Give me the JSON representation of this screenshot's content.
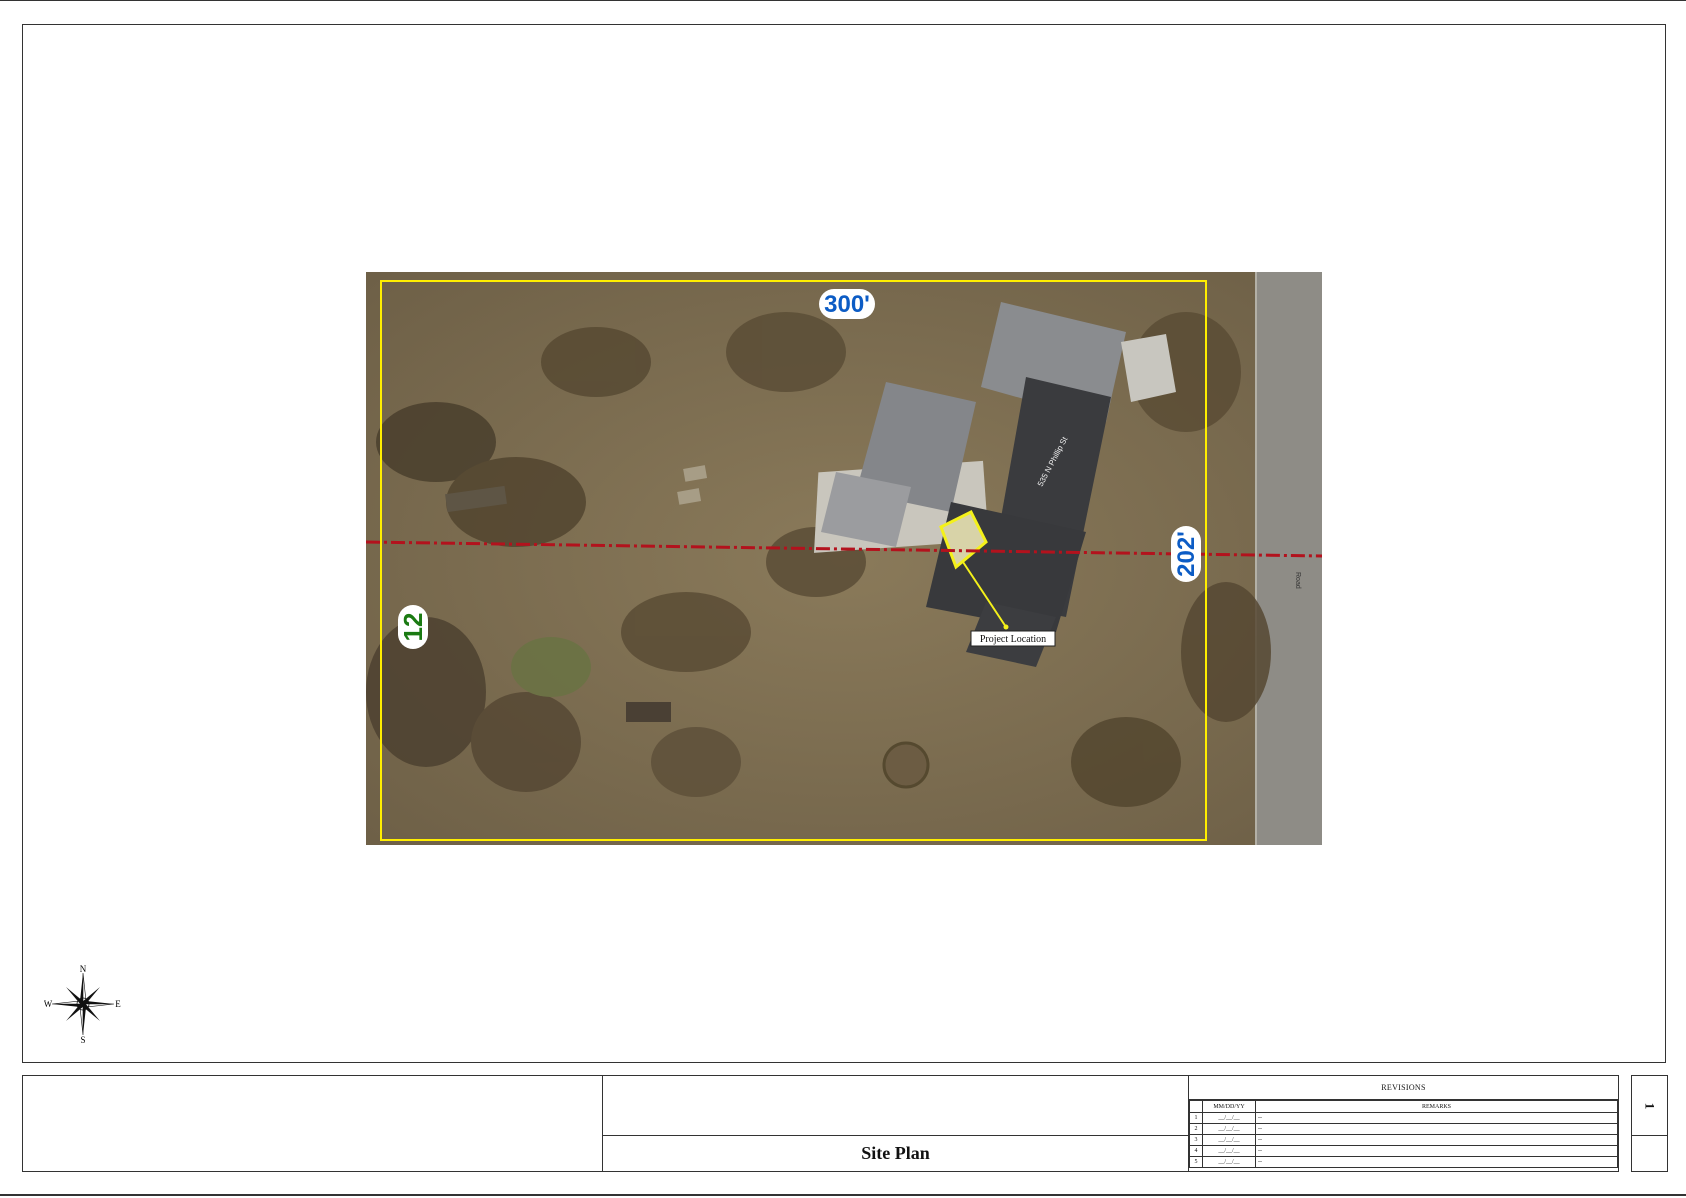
{
  "site_plan": {
    "dimension_top": "300'",
    "dimension_right": "202'",
    "left_label": "12",
    "callout": "Project Location",
    "road_label": "Road",
    "address_label": "535 N Phillip St",
    "colors": {
      "property_line": "#ffee00",
      "centerline": "#b3121d",
      "dimension_label": "#0c5cc5",
      "left_label": "#1a7a12",
      "ground": "#7e6f52",
      "roof": "#3e3f42"
    }
  },
  "compass": {
    "n": "N",
    "e": "E",
    "s": "S",
    "w": "W"
  },
  "title_block": {
    "sheet_title": "Site Plan",
    "sheet_number": "1",
    "revisions": {
      "title": "REVISIONS",
      "col_date": "MM/DD/YY",
      "col_remarks": "REMARKS",
      "rows": [
        {
          "num": "1",
          "date": "__/__/__",
          "remarks": "--"
        },
        {
          "num": "2",
          "date": "__/__/__",
          "remarks": "--"
        },
        {
          "num": "3",
          "date": "__/__/__",
          "remarks": "--"
        },
        {
          "num": "4",
          "date": "__/__/__",
          "remarks": "--"
        },
        {
          "num": "5",
          "date": "__/__/__",
          "remarks": "--"
        }
      ]
    }
  }
}
